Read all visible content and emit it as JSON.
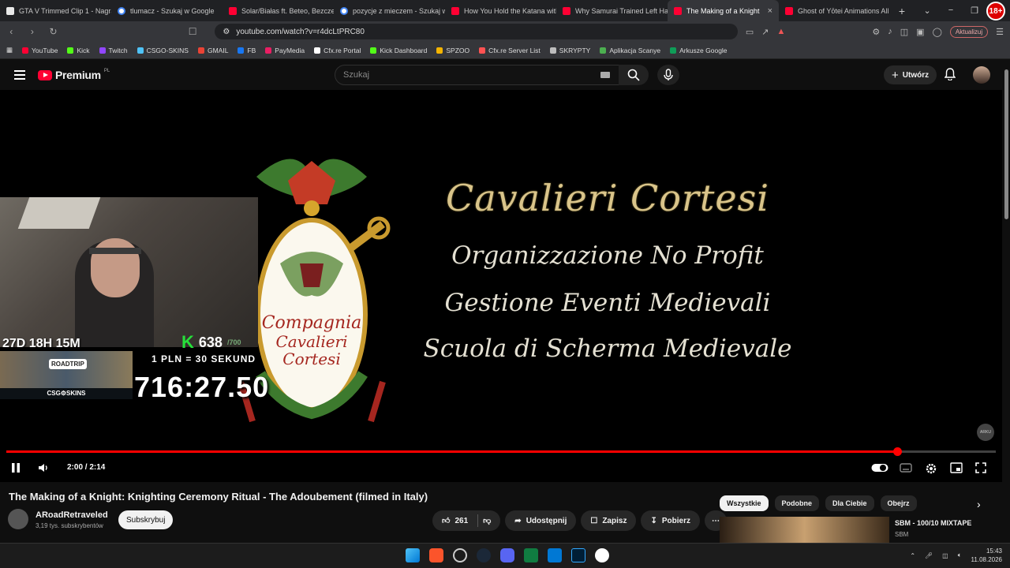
{
  "browser": {
    "tabs": [
      {
        "label": "GTA V Trimmed Clip 1 - Nagra",
        "icon": "m"
      },
      {
        "label": "tlumacz - Szukaj w Google",
        "icon": "g"
      },
      {
        "label": "Solar/Białas ft. Beteo, Bezczel",
        "icon": "yt"
      },
      {
        "label": "pozycje z mieczem - Szukaj w",
        "icon": "g"
      },
      {
        "label": "How You Hold the Katana with",
        "icon": "yt"
      },
      {
        "label": "Why Samurai Trained Left Han",
        "icon": "yt"
      },
      {
        "label": "The Making of a Knight",
        "icon": "yt",
        "active": true
      },
      {
        "label": "Ghost of Yōtei Animations All",
        "icon": "yt"
      }
    ],
    "url": "youtube.com/watch?v=r4dcLtPRC80",
    "update_label": "Aktualizuj",
    "profile_badge": "18+",
    "bookmarks": [
      {
        "label": "YouTube",
        "color": "#ff0033"
      },
      {
        "label": "Kick",
        "color": "#53fc18"
      },
      {
        "label": "Twitch",
        "color": "#9146ff"
      },
      {
        "label": "CSGO-SKINS",
        "color": "#4fc3f7"
      },
      {
        "label": "GMAIL",
        "color": "#ea4335"
      },
      {
        "label": "FB",
        "color": "#1877f2"
      },
      {
        "label": "PayMedia",
        "color": "#e91e63"
      },
      {
        "label": "Cfx.re Portal",
        "color": "#ffffff"
      },
      {
        "label": "Kick Dashboard",
        "color": "#53fc18"
      },
      {
        "label": "SPZOO",
        "color": "#f4b400"
      },
      {
        "label": "Cfx.re Server List",
        "color": "#ff5252"
      },
      {
        "label": "SKRYPTY",
        "color": "#bdbdbd"
      },
      {
        "label": "Aplikacja Scanye",
        "color": "#4caf50"
      },
      {
        "label": "Arkusze Google",
        "color": "#0f9d58"
      }
    ]
  },
  "youtube": {
    "logo": "Premium",
    "logo_region": "PL",
    "search_placeholder": "Szukaj",
    "create_label": "Utwórz"
  },
  "video": {
    "title_lines": [
      "Cavalieri Cortesi",
      "Organizzazione No Profit",
      "Gestione Eventi Medievali",
      "Scuola di Scherma Medievale"
    ],
    "crest_text": [
      "Compagnia",
      "Cavalieri",
      "Cortesi"
    ],
    "overlay": {
      "countdown": "27D 18H 15M",
      "kick_count": "638",
      "kick_goal": "/700",
      "rate": "1 PLN = 30 SEKUND",
      "roadtrip": "ROADTRIP",
      "csg": "CSG⚙SKINS",
      "big_timer": "716:27.50"
    },
    "progress": 0.9,
    "time": "2:00 / 2:14",
    "ambient_badge": "ARKU"
  },
  "meta": {
    "title": "The Making of a Knight: Knighting Ceremony Ritual - The Adoubement (filmed in Italy)",
    "channel": "ARoadRetraveled",
    "subscribers": "3,19 tys. subskrybentów",
    "subscribe_label": "Subskrybuj",
    "likes": "261",
    "share_label": "Udostępnij",
    "save_label": "Zapisz",
    "download_label": "Pobierz"
  },
  "chips": [
    "Wszystkie",
    "Podobne",
    "Dla Ciebie",
    "Obejrz"
  ],
  "recommendation": {
    "title": "SBM - 100/10 MIXTAPE",
    "channel": "SBM"
  },
  "taskbar": {
    "time": "15:43",
    "date": "11.08.2026"
  }
}
